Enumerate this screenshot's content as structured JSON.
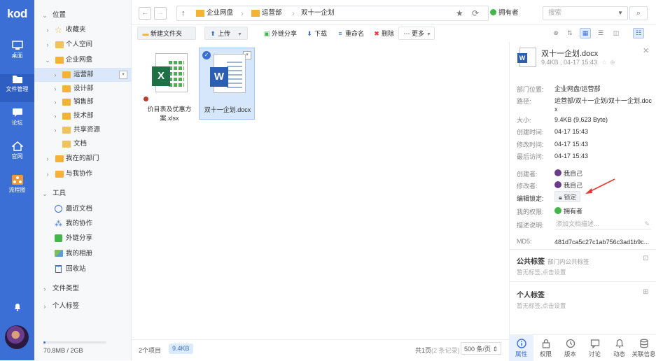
{
  "app": {
    "logo": "kod"
  },
  "leftnav": [
    {
      "label": "桌面",
      "icon": "desktop-icon"
    },
    {
      "label": "文件管理",
      "icon": "folder-icon"
    },
    {
      "label": "论坛",
      "icon": "chat-icon"
    },
    {
      "label": "官网",
      "icon": "home-icon"
    },
    {
      "label": "流程图",
      "icon": "flow-icon"
    }
  ],
  "tree": {
    "location": "位置",
    "favorites": "收藏夹",
    "personal": "个人空间",
    "enterprise": "企业网盘",
    "depts": [
      "运营部",
      "设计部",
      "销售部",
      "技术部",
      "共享资源",
      "文档"
    ],
    "mydept": "我在的部门",
    "collab": "与我协作",
    "tools": "工具",
    "tool_items": [
      "最近文档",
      "我的协作",
      "外链分享",
      "我的相册",
      "回收站"
    ],
    "filetype": "文件类型",
    "personal_tags": "个人标签",
    "quota": "70.8MB / 2GB"
  },
  "crumbs": [
    "企业网盘",
    "运营部",
    "双十一企划"
  ],
  "owner": "拥有者",
  "search": {
    "placeholder": "搜索"
  },
  "toolbar": {
    "new_folder": "新建文件夹",
    "upload": "上传",
    "share": "外链分享",
    "download": "下载",
    "rename": "重命名",
    "delete": "删除",
    "more": "更多"
  },
  "files": [
    {
      "name": "价目表及优惠方案.xlsx",
      "type": "xlsx"
    },
    {
      "name": "双十一企划.docx",
      "type": "docx"
    }
  ],
  "status": {
    "count": "2个项目",
    "size": "9.4KB",
    "page": "共1页",
    "page_note": "(2 条记录)",
    "per_page": "500 条/页"
  },
  "detail": {
    "title": "双十一企划.docx",
    "sub": "9.4KB , 04-17 15:43",
    "rows": [
      {
        "k": "部门位置:",
        "v": "企业网盘/运营部"
      },
      {
        "k": "路径:",
        "v": "运营部/双十一企划/双十一企划.docx"
      },
      {
        "k": "大小:",
        "v": "9.4KB (9,623 Byte)"
      },
      {
        "k": "创建时间:",
        "v": "04-17 15:43"
      },
      {
        "k": "修改时间:",
        "v": "04-17 15:43"
      },
      {
        "k": "最后访问:",
        "v": "04-17 15:43"
      }
    ],
    "creator_k": "创建者:",
    "creator": "我自己",
    "modifier_k": "修改者:",
    "modifier": "我自己",
    "lock_k": "编辑锁定:",
    "lock": "锁定",
    "perm_k": "我的权限:",
    "perm": "拥有者",
    "desc_k": "描述说明:",
    "desc_placeholder": "添加文档描述...",
    "md5_k": "MD5:",
    "md5": "481d7ca5c27c1ab756c3ad1b9c...",
    "public_tags": "公共标签",
    "public_tags_note": "部门内公共标签",
    "public_empty": "暂无标签,点击设置",
    "personal_tags": "个人标签",
    "personal_empty": "暂无标签,点击设置"
  },
  "ptabs": [
    {
      "label": "属性",
      "icon": "info-icon"
    },
    {
      "label": "权限",
      "icon": "lock-icon"
    },
    {
      "label": "版本",
      "icon": "history-icon"
    },
    {
      "label": "讨论",
      "icon": "comment-icon"
    },
    {
      "label": "动态",
      "icon": "bell-icon"
    },
    {
      "label": "关联信息",
      "icon": "database-icon"
    }
  ],
  "colors": {
    "accent": "#3b6fd6",
    "folder": "#f5b335",
    "owner": "#43b649"
  }
}
